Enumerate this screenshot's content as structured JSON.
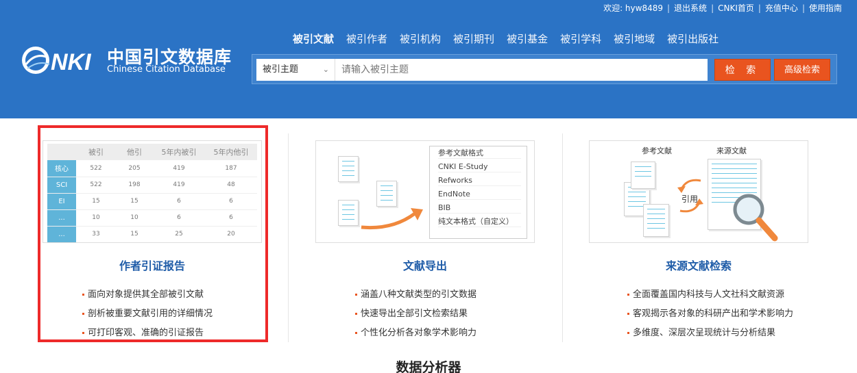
{
  "header": {
    "top_links": {
      "welcome": "欢迎: hyw8489",
      "logout": "退出系统",
      "cnki_home": "CNKI首页",
      "recharge": "充值中心",
      "guide": "使用指南"
    },
    "logo": {
      "brand": "CNKI",
      "name_cn": "中国引文数据库",
      "name_en": "Chinese Citation Database"
    },
    "tabs": [
      "被引文献",
      "被引作者",
      "被引机构",
      "被引期刊",
      "被引基金",
      "被引学科",
      "被引地域",
      "被引出版社"
    ],
    "search": {
      "field_selected": "被引主题",
      "placeholder": "请输入被引主题",
      "search_label": "检 索",
      "advanced_label": "高级检索"
    }
  },
  "panels": [
    {
      "title": "作者引证报告",
      "items": [
        "面向对象提供其全部被引文献",
        "剖析被重要文献引用的详细情况",
        "可打印客观、准确的引证报告"
      ],
      "table": {
        "headers": [
          "",
          "被引",
          "他引",
          "5年内被引",
          "5年内他引"
        ],
        "rows": [
          {
            "label": "核心",
            "values": [
              "522",
              "205",
              "419",
              "187"
            ]
          },
          {
            "label": "SCI",
            "values": [
              "522",
              "198",
              "419",
              "48"
            ]
          },
          {
            "label": "EI",
            "values": [
              "15",
              "15",
              "6",
              "6"
            ]
          },
          {
            "label": "...",
            "values": [
              "10",
              "10",
              "6",
              "6"
            ]
          },
          {
            "label": "...",
            "values": [
              "33",
              "15",
              "25",
              "20"
            ]
          }
        ]
      }
    },
    {
      "title": "文献导出",
      "items": [
        "涵盖八种文献类型的引文数据",
        "快速导出全部引文检索结果",
        "个性化分析各对象学术影响力"
      ],
      "formats": [
        "参考文献格式",
        "CNKI E-Study",
        "Refworks",
        "EndNote",
        "BIB",
        "纯文本格式（自定义）"
      ]
    },
    {
      "title": "来源文献检索",
      "items": [
        "全面覆盖国内科技与人文社科文献资源",
        "客观揭示各对象的科研产出和学术影响力",
        "多维度、深层次呈现统计与分析结果"
      ],
      "labels": {
        "left": "参考文献",
        "right": "来源文献",
        "center": "引用"
      }
    }
  ],
  "section_title": "数据分析器",
  "colors": {
    "header_bg": "#2b73c5",
    "accent": "#e9541f",
    "title_blue": "#1f5ca8",
    "highlight": "#ee2a2a"
  }
}
